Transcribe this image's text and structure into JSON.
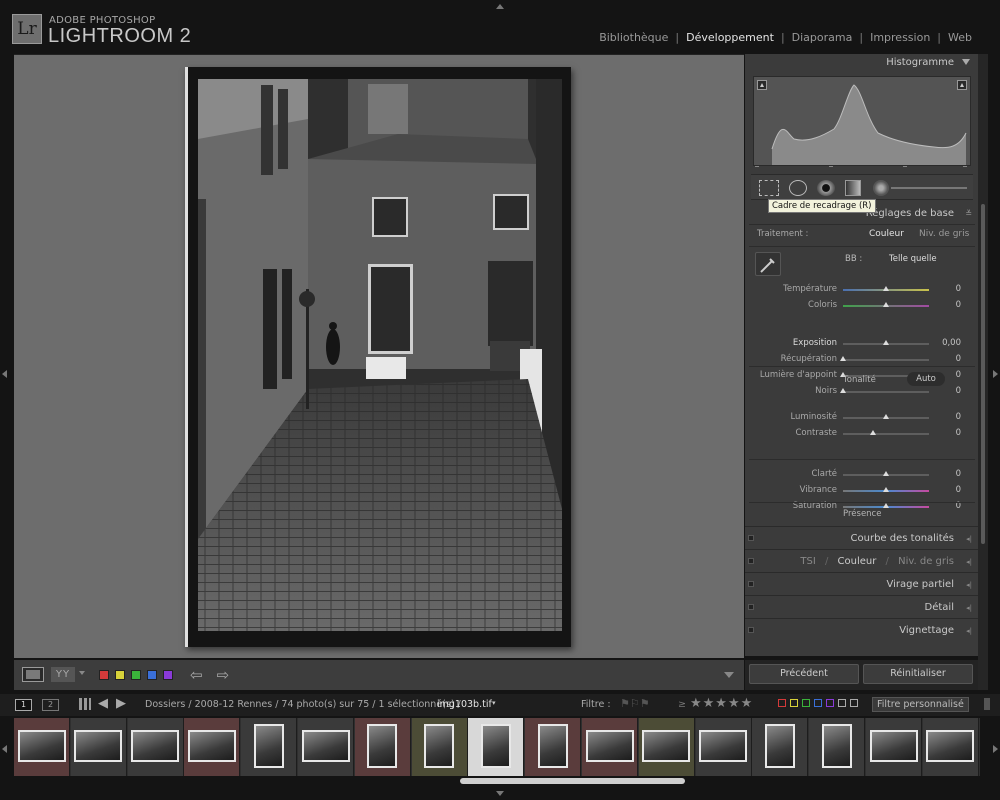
{
  "app": {
    "brand_small": "ADOBE PHOTOSHOP",
    "brand_big": "LIGHTROOM 2",
    "logo": "Lr"
  },
  "modules": [
    {
      "label": "Bibliothèque",
      "active": false
    },
    {
      "label": "Développement",
      "active": true
    },
    {
      "label": "Diaporama",
      "active": false
    },
    {
      "label": "Impression",
      "active": false
    },
    {
      "label": "Web",
      "active": false
    }
  ],
  "toolbar": {
    "view_mode_label": "YY",
    "color_labels": [
      "#d43a3a",
      "#d8d23a",
      "#3ab33a",
      "#3a6fd8",
      "#8a3ad8"
    ]
  },
  "right_panel": {
    "histogram_title": "Histogramme",
    "tooltip": "Cadre de recadrage (R)",
    "basic": {
      "title": "Réglages de base",
      "treatment_label": "Traitement :",
      "treatment_color": "Couleur",
      "treatment_gray": "Niv. de gris",
      "wb_label": "BB :",
      "wb_value": "Telle quelle",
      "tone_label": "Tonalité",
      "auto_label": "Auto",
      "presence_label": "Présence",
      "sliders": [
        {
          "label": "Température",
          "value": "0",
          "pos": 0.5
        },
        {
          "label": "Coloris",
          "value": "0",
          "pos": 0.5
        },
        {
          "label": "Exposition",
          "value": "0,00",
          "pos": 0.5
        },
        {
          "label": "Récupération",
          "value": "0",
          "pos": 0.0
        },
        {
          "label": "Lumière d'appoint",
          "value": "0",
          "pos": 0.0
        },
        {
          "label": "Noirs",
          "value": "0",
          "pos": 0.0
        },
        {
          "label": "Luminosité",
          "value": "0",
          "pos": 0.5
        },
        {
          "label": "Contraste",
          "value": "0",
          "pos": 0.35
        },
        {
          "label": "Clarté",
          "value": "0",
          "pos": 0.5
        },
        {
          "label": "Vibrance",
          "value": "0",
          "pos": 0.5
        },
        {
          "label": "Saturation",
          "value": "0",
          "pos": 0.5
        }
      ]
    },
    "collapsed_panels": [
      "Courbe des tonalités",
      "Virage partiel",
      "Détail",
      "Vignettage"
    ],
    "hsl": {
      "tsl": "TSI",
      "color": "Couleur",
      "gray": "Niv. de gris",
      "sep": "/"
    },
    "prev_button": "Précédent",
    "reset_button": "Réinitialiser"
  },
  "filmstrip": {
    "page1": "1",
    "page2": "2",
    "path": "Dossiers / 2008-12 Rennes / 74 photo(s) sur 75 / 1 sélectionné(s) /",
    "filename": "img103b.tif",
    "filter_label": "Filtre :",
    "stars": "★★★★★",
    "gte": "≥",
    "custom_filter": "Filtre personnalisé",
    "thumbs": [
      {
        "tint": "#5a3c3c",
        "w": 48,
        "h": 32
      },
      {
        "tint": "#3a3a3a",
        "w": 48,
        "h": 32
      },
      {
        "tint": "#3a3a3a",
        "w": 48,
        "h": 32
      },
      {
        "tint": "#5a3c3c",
        "w": 48,
        "h": 32
      },
      {
        "tint": "#3a3a3a",
        "w": 30,
        "h": 44
      },
      {
        "tint": "#3a3a3a",
        "w": 48,
        "h": 32
      },
      {
        "tint": "#5a3c3c",
        "w": 30,
        "h": 44
      },
      {
        "tint": "#4c4c36",
        "w": 30,
        "h": 44
      },
      {
        "tint": "#d8d8d8",
        "w": 30,
        "h": 44
      },
      {
        "tint": "#5a3c3c",
        "w": 30,
        "h": 44
      },
      {
        "tint": "#5a3c3c",
        "w": 48,
        "h": 32
      },
      {
        "tint": "#4c4c36",
        "w": 48,
        "h": 32
      },
      {
        "tint": "#3a3a3a",
        "w": 48,
        "h": 32
      },
      {
        "tint": "#3a3a3a",
        "w": 30,
        "h": 44
      },
      {
        "tint": "#3a3a3a",
        "w": 30,
        "h": 44
      },
      {
        "tint": "#3a3a3a",
        "w": 48,
        "h": 32
      },
      {
        "tint": "#3a3a3a",
        "w": 48,
        "h": 32
      }
    ]
  }
}
